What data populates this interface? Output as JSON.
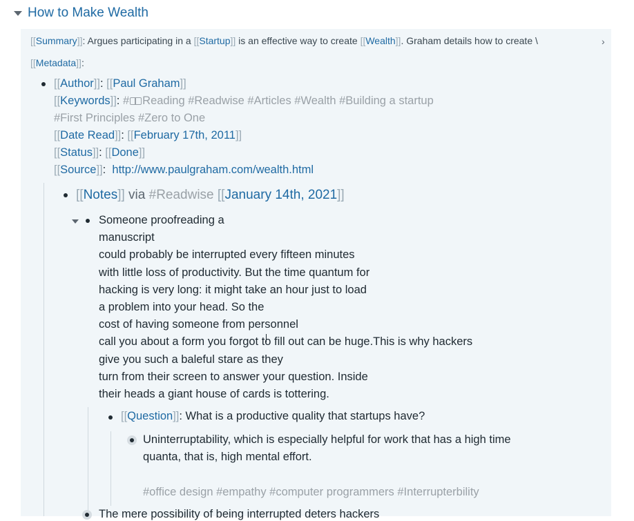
{
  "page": {
    "title": "How to Make Wealth"
  },
  "summary": {
    "label": "Summary",
    "prefix": ": Argues participating in a ",
    "startup_ref": "Startup",
    "middle": " is an effective way to create ",
    "wealth_ref": "Wealth",
    "suffix": ". Graham details how to create \\"
  },
  "metadata": {
    "label": "Metadata",
    "suffix": ":"
  },
  "author": {
    "label": "Author",
    "value": "Paul Graham"
  },
  "keywords": {
    "label": "Keywords",
    "hash_before_icon": "#",
    "line1_rest": "Reading #Readwise #Articles #Wealth #Building a startup",
    "line2": "#First Principles #Zero to One"
  },
  "date_read": {
    "label": "Date Read",
    "value": "February 17th, 2011"
  },
  "status": {
    "label": "Status",
    "value": "Done"
  },
  "source": {
    "label": "Source",
    "url": "http://www.paulgraham.com/wealth.html"
  },
  "notes_header": {
    "notes_label": "Notes",
    "via": " via ",
    "tag": "#Readwise",
    "date": "January 14th, 2021"
  },
  "highlight": {
    "lines": [
      "Someone proofreading a",
      "manuscript",
      "could probably be interrupted every fifteen minutes",
      "with little loss of productivity.  But the time quantum for",
      "hacking is very long: it might take an hour just to load",
      "a problem into your head.  So the",
      "cost of having someone from personnel",
      "call you about a form you forgot to fill out can be huge.This is why hackers",
      "give you such a baleful stare as they",
      "turn from their screen to answer your question.  Inside",
      "their heads a giant house of cards is tottering."
    ]
  },
  "question": {
    "label": "Question",
    "text": ": What is a productive quality that startups have?"
  },
  "answer": {
    "line1": "Uninterruptability, which is especially helpful for work that has a high time",
    "line2": "quanta, that is, high mental effort.",
    "tags": "#office design #empathy #computer programmers #Interrupterbility"
  },
  "next_highlight": {
    "text": "The mere possibility of being interrupted deters hackers"
  }
}
